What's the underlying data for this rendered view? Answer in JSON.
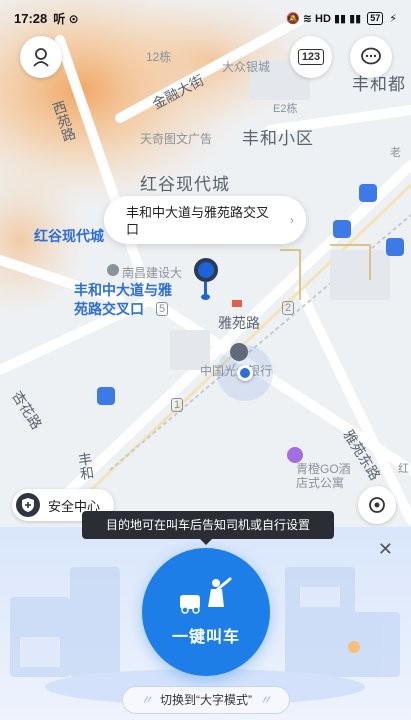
{
  "status_bar": {
    "time": "17:28",
    "app_indicators": "听 ⊙",
    "right_icons": "🔕 ≋ HD ▮▮ ▮▮",
    "battery": "57"
  },
  "map": {
    "streets": {
      "jinrong": "金融大街",
      "xiyuan": "西苑路",
      "yayuan": "雅苑路",
      "yayuan_east": "雅苑东路",
      "fenghe_vert": "丰和",
      "lilu": "杏花路"
    },
    "areas": {
      "fenghe_district": "丰和小区",
      "honggu_city": "红谷现代城",
      "fenghe_du": "丰和都"
    },
    "blue_labels": {
      "honggu_left": "红谷现代城"
    },
    "pois": {
      "building_12": "12栋",
      "dazhong": "大众银城",
      "tianqi": "天奇图文广告",
      "e2": "E2栋",
      "nanchang": "南昌建设大",
      "bank": "中国光大银行",
      "qingcheng": "青橙GO酒店式公寓",
      "lao": "老",
      "hong": "红"
    },
    "bus_numbers": {
      "b5": "5",
      "b2": "2",
      "b1": "1"
    }
  },
  "header": {
    "keyboard_label": "123"
  },
  "route_card": {
    "text": "丰和中大道与雅苑路交叉口",
    "chevron": "›"
  },
  "destination": {
    "label": "丰和中大道与雅苑路交叉口"
  },
  "safety_center": {
    "label": "安全中心"
  },
  "tooltip": {
    "text": "目的地可在叫车后告知司机或自行设置"
  },
  "call_button": {
    "label": "一键叫车"
  },
  "switch_mode": {
    "label": "切换到“大字模式”",
    "deco_left": "〃",
    "deco_right": "〃"
  },
  "colors": {
    "accent_blue": "#1e7ee8",
    "label_blue": "#2c6fd9",
    "heat_orange": "#f7a45a"
  }
}
